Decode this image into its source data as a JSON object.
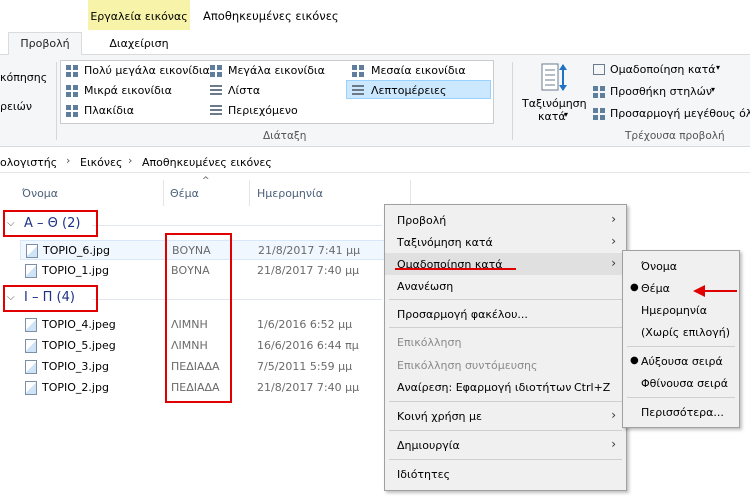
{
  "window": {
    "context_tab": "Εργαλεία εικόνας",
    "title": "Αποθηκευμένες εικόνες",
    "tabs": [
      "Προβολή",
      "Διαχείριση"
    ]
  },
  "ribbon": {
    "left_cut": [
      "κόπησης",
      "ρειών"
    ],
    "layout": {
      "items": [
        "Πολύ μεγάλα εικονίδια",
        "Μεγάλα εικονίδια",
        "Μεσαία εικονίδια",
        "Μικρά εικονίδια",
        "Λίστα",
        "Λεπτομέρειες",
        "Πλακίδια",
        "Περιεχόμενο"
      ],
      "label": "Διάταξη"
    },
    "current_view": {
      "sort_label": "Ταξινόμηση",
      "sort_label2": "κατά",
      "group_by": "Ομαδοποίηση κατά",
      "add_columns": "Προσθήκη στηλών",
      "size_columns": "Προσαρμογή μεγέθους όλ",
      "label": "Τρέχουσα προβολή"
    }
  },
  "address": {
    "crumbs": [
      "ολογιστής",
      "Εικόνες",
      "Αποθηκευμένες εικόνες"
    ]
  },
  "columns": [
    "Όνομα",
    "Θέμα",
    "Ημερομηνία"
  ],
  "groups": [
    {
      "header": "Α – Θ (2)",
      "files": [
        {
          "name": "TOPIO_6.jpg",
          "subject": "ΒΟΥΝΑ",
          "date": "21/8/2017 7:41 μμ"
        },
        {
          "name": "TOPIO_1.jpg",
          "subject": "ΒΟΥΝΑ",
          "date": "21/8/2017 7:40 μμ"
        }
      ]
    },
    {
      "header": "Ι – Π (4)",
      "files": [
        {
          "name": "TOPIO_4.jpeg",
          "subject": "ΛΙΜΝΗ",
          "date": "1/6/2016 6:52 μμ"
        },
        {
          "name": "TOPIO_5.jpeg",
          "subject": "ΛΙΜΝΗ",
          "date": "16/6/2016 6:44 πμ"
        },
        {
          "name": "TOPIO_3.jpg",
          "subject": "ΠΕΔΙΑΔΑ",
          "date": "7/5/2011 5:59 μμ"
        },
        {
          "name": "TOPIO_2.jpg",
          "subject": "ΠΕΔΙΑΔΑ",
          "date": "21/8/2017 7:40 μμ"
        }
      ]
    }
  ],
  "context_menu": {
    "view": "Προβολή",
    "sort_by": "Ταξινόμηση κατά",
    "group_by": "Ομαδοποίηση κατά",
    "refresh": "Ανανέωση",
    "customize": "Προσαρμογή φακέλου...",
    "paste": "Επικόλληση",
    "paste_shortcut": "Επικόλληση συντόμευσης",
    "undo": "Αναίρεση: Εφαρμογή ιδιοτήτων",
    "undo_key": "Ctrl+Z",
    "share": "Κοινή χρήση με",
    "new": "Δημιουργία",
    "properties": "Ιδιότητες"
  },
  "submenu": {
    "name": "Όνομα",
    "subject": "Θέμα",
    "date": "Ημερομηνία",
    "none": "(Χωρίς επιλογή)",
    "ascending": "Αύξουσα σειρά",
    "descending": "Φθίνουσα σειρά",
    "more": "Περισσότερα..."
  },
  "colors": {
    "group_header": "#1e3287",
    "annotation": "#e00000",
    "selection": "#cce8ff"
  }
}
